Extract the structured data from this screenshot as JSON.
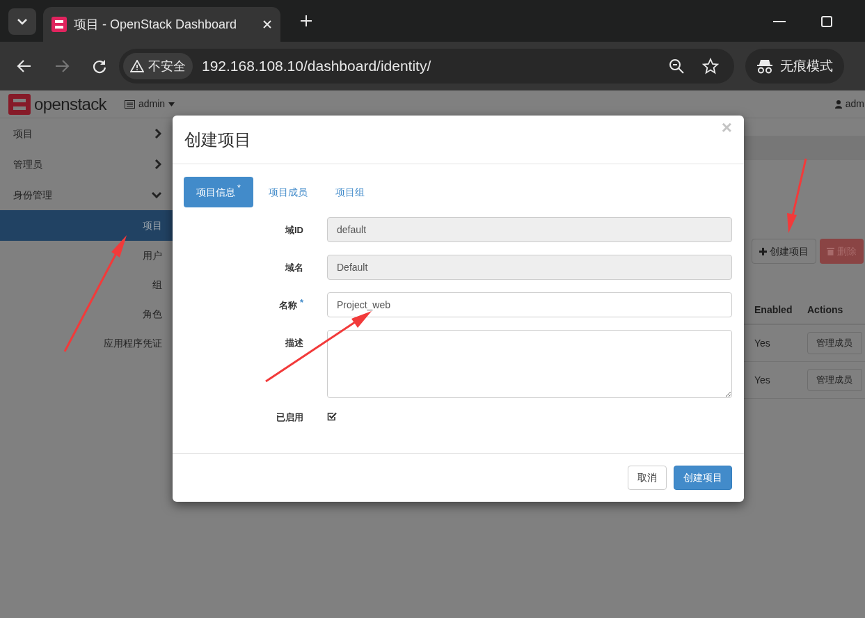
{
  "browser": {
    "tab_title": "项目 - OpenStack Dashboard",
    "security": "不安全",
    "url": "192.168.108.10/dashboard/identity/",
    "profile": "无痕模式"
  },
  "header": {
    "logo": "openstack",
    "project_menu": "admin",
    "user_menu": "adm"
  },
  "sidebar": {
    "items": [
      {
        "label": "项目",
        "expanded": false
      },
      {
        "label": "管理员",
        "expanded": false
      },
      {
        "label": "身份管理",
        "expanded": true,
        "children": [
          {
            "label": "项目",
            "selected": true
          },
          {
            "label": "用户",
            "selected": false
          },
          {
            "label": "组",
            "selected": false
          },
          {
            "label": "角色",
            "selected": false
          },
          {
            "label": "应用程序凭证",
            "selected": false
          }
        ]
      }
    ]
  },
  "page": {
    "toolbar": [
      {
        "label": "创建项目",
        "kind": "create"
      },
      {
        "label": "删除",
        "kind": "delete"
      }
    ],
    "table": {
      "columns": [
        "Enabled",
        "Actions"
      ],
      "rows": [
        {
          "enabled": "Yes",
          "action": "管理成员"
        },
        {
          "enabled": "Yes",
          "action": "管理成员"
        }
      ]
    }
  },
  "modal": {
    "title": "创建项目",
    "close": "×",
    "tabs": [
      {
        "label": "项目信息",
        "mark": "*",
        "selected": true
      },
      {
        "label": "项目成员",
        "selected": false
      },
      {
        "label": "项目组",
        "selected": false
      }
    ],
    "fields": [
      {
        "label": "域ID",
        "kind": "text",
        "value": "default",
        "disabled": true
      },
      {
        "label": "域名",
        "kind": "text",
        "value": "Default",
        "disabled": true
      },
      {
        "label": "名称",
        "mark": "*",
        "kind": "text",
        "value": "Project_web",
        "disabled": false
      },
      {
        "label": "描述",
        "kind": "textarea",
        "disabled": false
      },
      {
        "label": "已启用",
        "kind": "checkbox",
        "checked": true
      }
    ],
    "buttons": [
      {
        "label": "取消",
        "kind": "default"
      },
      {
        "label": "创建项目",
        "kind": "primary"
      }
    ]
  }
}
